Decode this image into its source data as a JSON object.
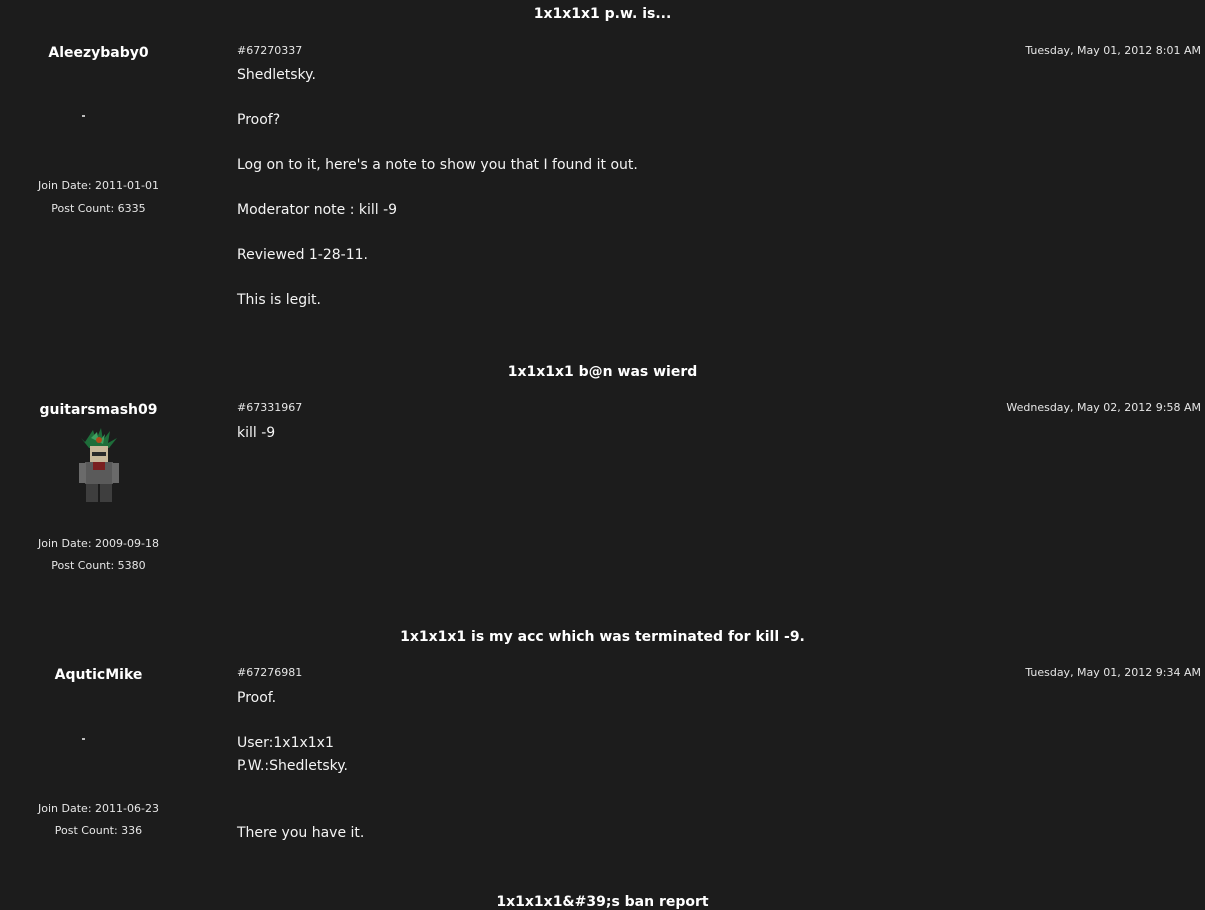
{
  "threads": [
    {
      "title": "1x1x1x1 p.w. is...",
      "author": "Aleezybaby0",
      "join_date": "Join Date: 2011-01-01",
      "post_count": "Post Count: 6335",
      "post_id": "#67270337",
      "date": "Tuesday, May 01, 2012 8:01 AM",
      "body": [
        "Shedletsky.",
        "",
        "Proof?",
        "",
        "Log on to it, here's a note to show you that I found it out.",
        "",
        "Moderator note : kill -9",
        "",
        "Reviewed 1-28-11.",
        "",
        "This is legit."
      ]
    },
    {
      "title": "1x1x1x1 b@n was wierd",
      "author": "guitarsmash09",
      "join_date": "Join Date: 2009-09-18",
      "post_count": "Post Count: 5380",
      "post_id": "#67331967",
      "date": "Wednesday, May 02, 2012 9:58 AM",
      "body": [
        "kill -9"
      ]
    },
    {
      "title": "1x1x1x1 is my acc which was terminated for kill -9.",
      "author": "AquticMike",
      "join_date": "Join Date: 2011-06-23",
      "post_count": "Post Count: 336",
      "post_id": "#67276981",
      "date": "Tuesday, May 01, 2012 9:34 AM",
      "body": [
        "Proof.",
        "",
        "User:1x1x1x1",
        "P.W.:Shedletsky.",
        "",
        "",
        "There you have it."
      ]
    },
    {
      "title": "1x1x1x1&#39;s ban report"
    }
  ],
  "colors": {
    "background": "#1c1c1c",
    "text": "#f0f0f0"
  }
}
